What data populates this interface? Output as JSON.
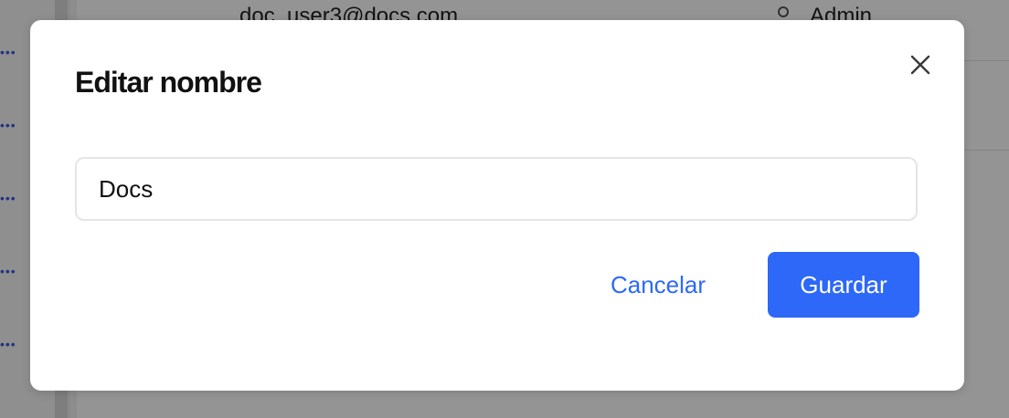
{
  "background": {
    "row_email": "doc_user3@docs.com",
    "row_role": "Admin",
    "row_more_icon": "more-dots-icon"
  },
  "dialog": {
    "title": "Editar nombre",
    "close_icon": "close-icon",
    "name_input": {
      "value": "Docs"
    },
    "cancel_label": "Cancelar",
    "save_label": "Guardar"
  },
  "colors": {
    "accent": "#2d68f8",
    "title": "#111111",
    "input_border": "#e5e5e5"
  }
}
